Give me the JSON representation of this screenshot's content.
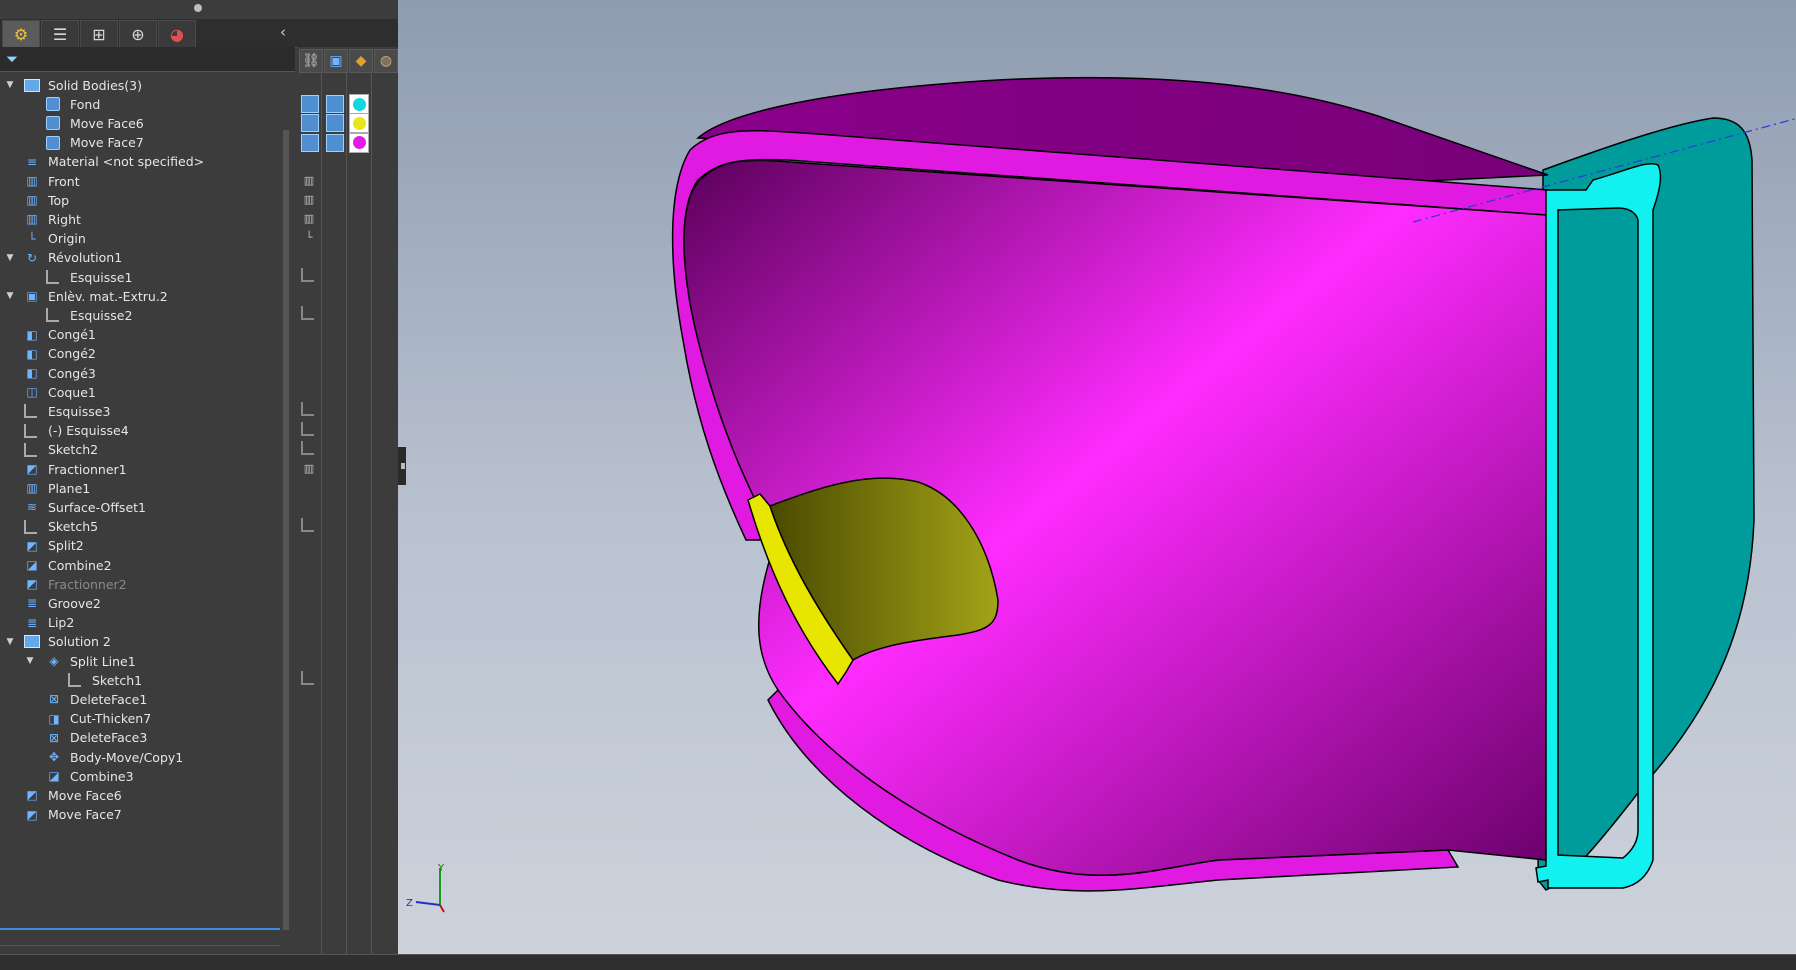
{
  "tabs": [
    {
      "name": "feature-manager-tab",
      "icon": "gear-part-icon"
    },
    {
      "name": "property-manager-tab",
      "icon": "list-icon"
    },
    {
      "name": "configuration-manager-tab",
      "icon": "tree-icon"
    },
    {
      "name": "dimxpert-tab",
      "icon": "crosshair-icon"
    },
    {
      "name": "display-manager-tab",
      "icon": "color-wheel-icon"
    }
  ],
  "tree": [
    {
      "label": "Solid Bodies(3)",
      "icon": "folder-icon",
      "expanded": true
    },
    {
      "label": "Fond",
      "icon": "solid-body-icon"
    },
    {
      "label": "Move Face6",
      "icon": "solid-body-icon"
    },
    {
      "label": "Move Face7",
      "icon": "solid-body-icon"
    },
    {
      "label": "Material <not specified>",
      "icon": "material-icon"
    },
    {
      "label": "Front",
      "icon": "plane-icon"
    },
    {
      "label": "Top",
      "icon": "plane-icon"
    },
    {
      "label": "Right",
      "icon": "plane-icon"
    },
    {
      "label": "Origin",
      "icon": "origin-icon"
    },
    {
      "label": "Révolution1",
      "icon": "revolve-icon",
      "expanded": true
    },
    {
      "label": "Esquisse1",
      "icon": "sketch-icon"
    },
    {
      "label": "Enlèv. mat.-Extru.2",
      "icon": "cut-extrude-icon",
      "expanded": true
    },
    {
      "label": "Esquisse2",
      "icon": "sketch-icon"
    },
    {
      "label": "Congé1",
      "icon": "fillet-icon"
    },
    {
      "label": "Congé2",
      "icon": "fillet-icon"
    },
    {
      "label": "Congé3",
      "icon": "fillet-icon"
    },
    {
      "label": "Coque1",
      "icon": "shell-icon"
    },
    {
      "label": "Esquisse3",
      "icon": "sketch-icon"
    },
    {
      "label": "(-) Esquisse4",
      "icon": "sketch-icon"
    },
    {
      "label": "Sketch2",
      "icon": "sketch-icon"
    },
    {
      "label": "Fractionner1",
      "icon": "split-icon"
    },
    {
      "label": "Plane1",
      "icon": "plane-icon"
    },
    {
      "label": "Surface-Offset1",
      "icon": "surface-offset-icon"
    },
    {
      "label": "Sketch5",
      "icon": "sketch-icon"
    },
    {
      "label": "Split2",
      "icon": "split-icon"
    },
    {
      "label": "Combine2",
      "icon": "combine-icon"
    },
    {
      "label": "Fractionner2",
      "icon": "split-icon",
      "suppressed": true
    },
    {
      "label": "Groove2",
      "icon": "groove-icon"
    },
    {
      "label": "Lip2",
      "icon": "lip-icon"
    },
    {
      "label": "Solution 2",
      "icon": "folder-icon",
      "expanded": true
    },
    {
      "label": "Split Line1",
      "icon": "split-line-icon",
      "expanded": true
    },
    {
      "label": "Sketch1",
      "icon": "sketch-icon"
    },
    {
      "label": "DeleteFace1",
      "icon": "delete-face-icon"
    },
    {
      "label": "Cut-Thicken7",
      "icon": "cut-thicken-icon"
    },
    {
      "label": "DeleteFace3",
      "icon": "delete-face-icon"
    },
    {
      "label": "Body-Move/Copy1",
      "icon": "move-copy-icon"
    },
    {
      "label": "Combine3",
      "icon": "combine-icon"
    },
    {
      "label": "Move Face6",
      "icon": "move-face-icon"
    },
    {
      "label": "Move Face7",
      "icon": "move-face-icon"
    }
  ],
  "display_state": {
    "body_colors": [
      "#12d6e0",
      "#e6e61a",
      "#e61ae6"
    ]
  },
  "colors": {
    "magenta": "#e01ae0",
    "cyan": "#13f0f0",
    "teal": "#009a9a",
    "yellow": "#e8e600",
    "olive": "#8a8a10"
  },
  "triad": {
    "y": "Y",
    "z": "Z"
  }
}
